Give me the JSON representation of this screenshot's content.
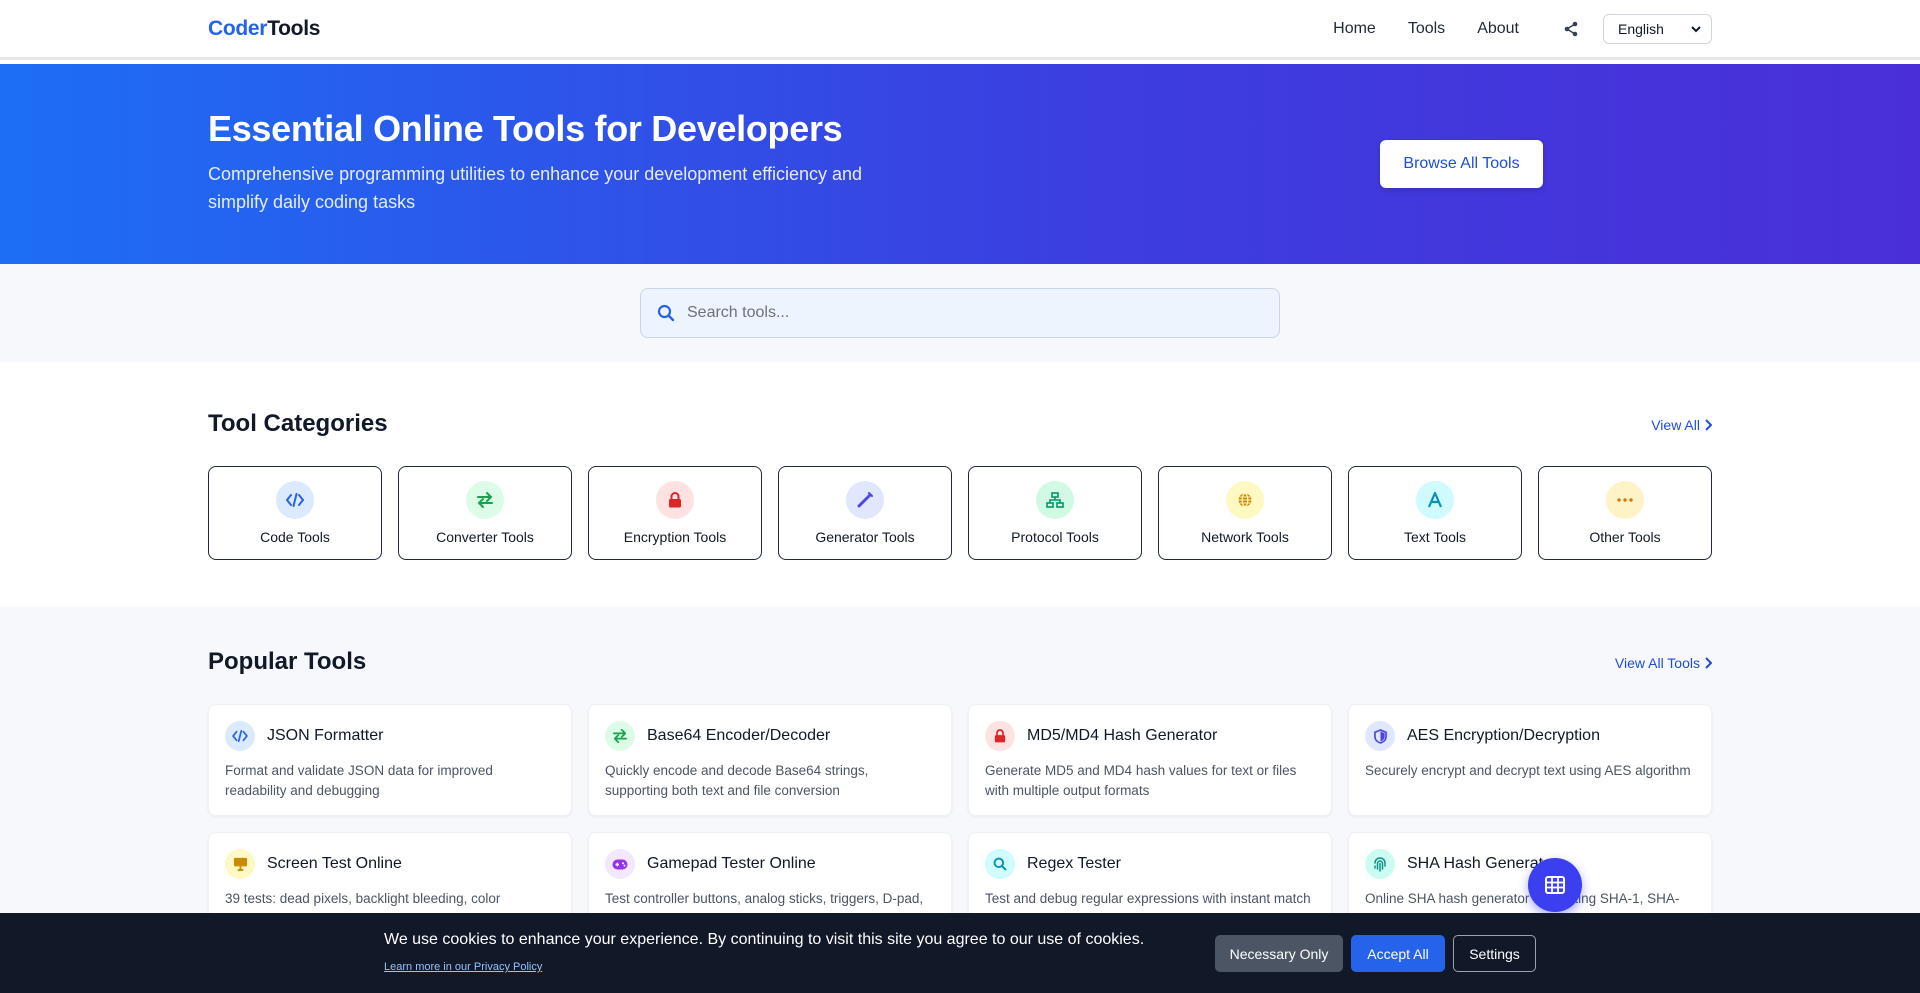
{
  "header": {
    "logo_part1": "Coder",
    "logo_part2": "Tools",
    "nav": [
      {
        "label": "Home"
      },
      {
        "label": "Tools"
      },
      {
        "label": "About"
      }
    ],
    "language": "English"
  },
  "hero": {
    "title": "Essential Online Tools for Developers",
    "subtitle": "Comprehensive programming utilities to enhance your development efficiency and simplify daily coding tasks",
    "browse_label": "Browse All Tools"
  },
  "search": {
    "placeholder": "Search tools..."
  },
  "categories": {
    "title": "Tool Categories",
    "view_all": "View All",
    "items": [
      {
        "label": "Code Tools",
        "icon": "code-icon",
        "bg": "#dbeafe",
        "color": "#2563eb"
      },
      {
        "label": "Converter Tools",
        "icon": "exchange-icon",
        "bg": "#dcfce7",
        "color": "#16a34a"
      },
      {
        "label": "Encryption Tools",
        "icon": "lock-icon",
        "bg": "#fee2e2",
        "color": "#dc2626"
      },
      {
        "label": "Generator Tools",
        "icon": "magic-wand-icon",
        "bg": "#e0e7ff",
        "color": "#4f46e5"
      },
      {
        "label": "Protocol Tools",
        "icon": "network-icon",
        "bg": "#d1fae5",
        "color": "#059669"
      },
      {
        "label": "Network Tools",
        "icon": "globe-icon",
        "bg": "#fef9c3",
        "color": "#ca8a04"
      },
      {
        "label": "Text Tools",
        "icon": "text-icon",
        "bg": "#cffafe",
        "color": "#0891b2"
      },
      {
        "label": "Other Tools",
        "icon": "ellipsis-icon",
        "bg": "#fef3c7",
        "color": "#d97706"
      }
    ]
  },
  "popular": {
    "title": "Popular Tools",
    "view_all": "View All Tools",
    "items": [
      {
        "name": "JSON Formatter",
        "desc": "Format and validate JSON data for improved readability and debugging",
        "icon": "code-icon",
        "bg": "#dbeafe",
        "color": "#2563eb"
      },
      {
        "name": "Base64 Encoder/Decoder",
        "desc": "Quickly encode and decode Base64 strings, supporting both text and file conversion",
        "icon": "exchange-icon",
        "bg": "#dcfce7",
        "color": "#16a34a"
      },
      {
        "name": "MD5/MD4 Hash Generator",
        "desc": "Generate MD5 and MD4 hash values for text or files with multiple output formats",
        "icon": "lock-icon",
        "bg": "#fee2e2",
        "color": "#dc2626"
      },
      {
        "name": "AES Encryption/Decryption",
        "desc": "Securely encrypt and decrypt text using AES algorithm",
        "icon": "shield-icon",
        "bg": "#e0e7ff",
        "color": "#4f46e5"
      },
      {
        "name": "Screen Test Online",
        "desc": "39 tests: dead pixels, backlight bleeding, color",
        "icon": "monitor-icon",
        "bg": "#fef9c3",
        "color": "#ca8a04"
      },
      {
        "name": "Gamepad Tester Online",
        "desc": "Test controller buttons, analog sticks, triggers, D-pad,",
        "icon": "gamepad-icon",
        "bg": "#f3e8ff",
        "color": "#9333ea"
      },
      {
        "name": "Regex Tester",
        "desc": "Test and debug regular expressions with instant match",
        "icon": "search-icon",
        "bg": "#cffafe",
        "color": "#0891b2"
      },
      {
        "name": "SHA Hash Generator",
        "desc": "Online SHA hash generator supporting SHA-1, SHA-",
        "icon": "fingerprint-icon",
        "bg": "#ccfbf1",
        "color": "#0d9488"
      }
    ]
  },
  "cookie": {
    "message": "We use cookies to enhance your experience. By continuing to visit this site you agree to our use of cookies.",
    "privacy_link": "Learn more in our Privacy Policy",
    "necessary_label": "Necessary Only",
    "accept_label": "Accept All",
    "settings_label": "Settings"
  }
}
